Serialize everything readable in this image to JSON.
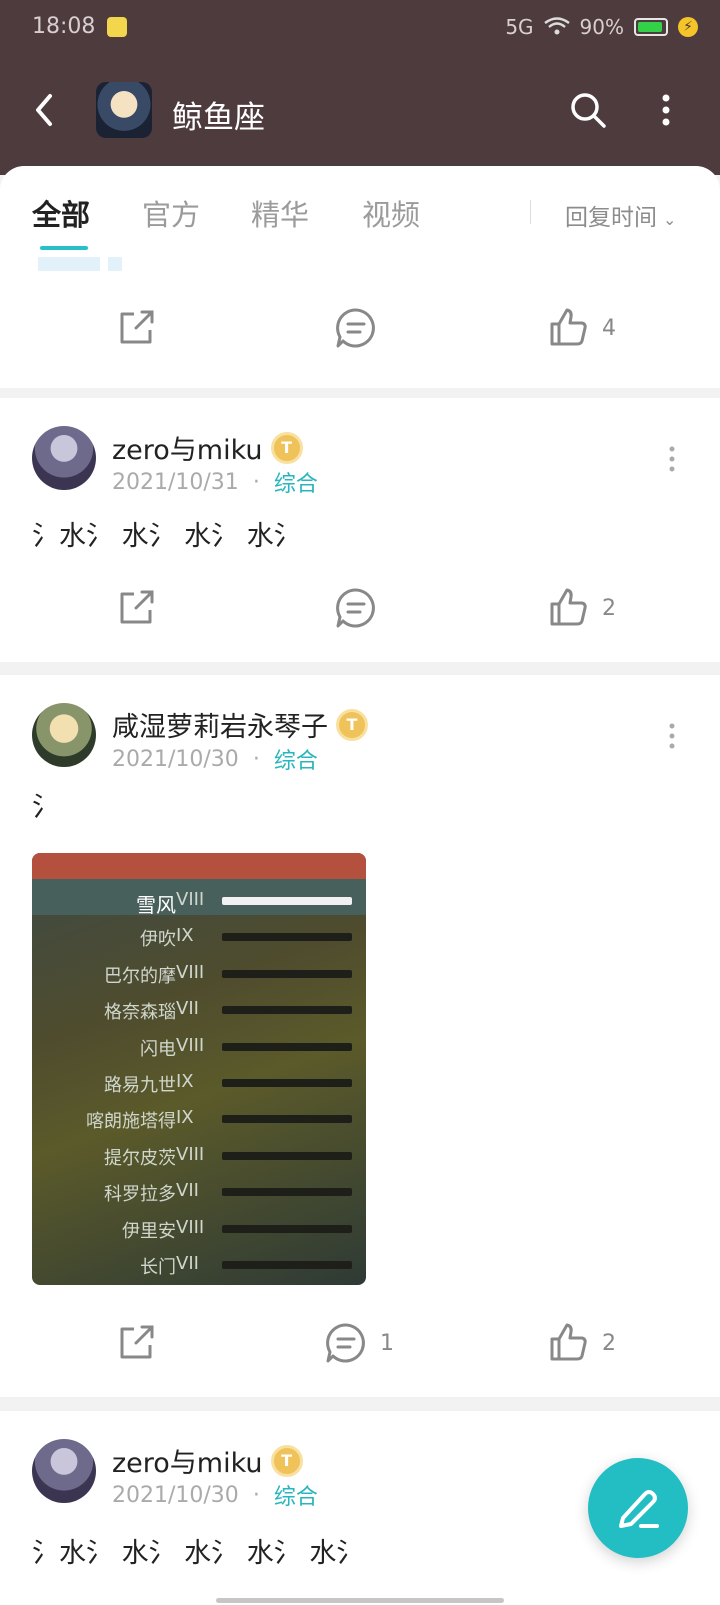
{
  "status_bar": {
    "time": "18:08",
    "network": "5G",
    "battery": "90%"
  },
  "header": {
    "title": "鲸鱼座"
  },
  "tabs": [
    {
      "label": "全部"
    },
    {
      "label": "官方"
    },
    {
      "label": "精华"
    },
    {
      "label": "视频"
    }
  ],
  "sort": {
    "label": "回复时间"
  },
  "first_actions": {
    "like_count": "4"
  },
  "posts": [
    {
      "author": "zero与miku",
      "badge": "T",
      "date": "2021/10/31",
      "category": "综合",
      "text": "氵水氵 水氵 水氵 水氵",
      "comment_count": "",
      "like_count": "2"
    },
    {
      "author": "咸湿萝莉岩永琴子",
      "badge": "T",
      "date": "2021/10/30",
      "category": "综合",
      "text": "氵",
      "comment_count": "1",
      "like_count": "2",
      "image": {
        "ships": [
          {
            "name": "雪风",
            "tier": "VIII"
          },
          {
            "name": "伊吹",
            "tier": "IX"
          },
          {
            "name": "巴尔的摩",
            "tier": "VIII"
          },
          {
            "name": "格奈森瑙",
            "tier": "VII"
          },
          {
            "name": "闪电",
            "tier": "VIII"
          },
          {
            "name": "路易九世",
            "tier": "IX"
          },
          {
            "name": "喀朗施塔得",
            "tier": "IX"
          },
          {
            "name": "提尔皮茨",
            "tier": "VIII"
          },
          {
            "name": "科罗拉多",
            "tier": "VII"
          },
          {
            "name": "伊里安",
            "tier": "VIII"
          },
          {
            "name": "长门",
            "tier": "VII"
          }
        ]
      }
    },
    {
      "author": "zero与miku",
      "badge": "T",
      "date": "2021/10/30",
      "category": "综合",
      "text": "氵水氵 水氵 水氵 水氵 水氵"
    }
  ],
  "colors": {
    "header_bg": "#4e3b3e",
    "accent": "#28c0c6",
    "fab": "#22bec4"
  }
}
